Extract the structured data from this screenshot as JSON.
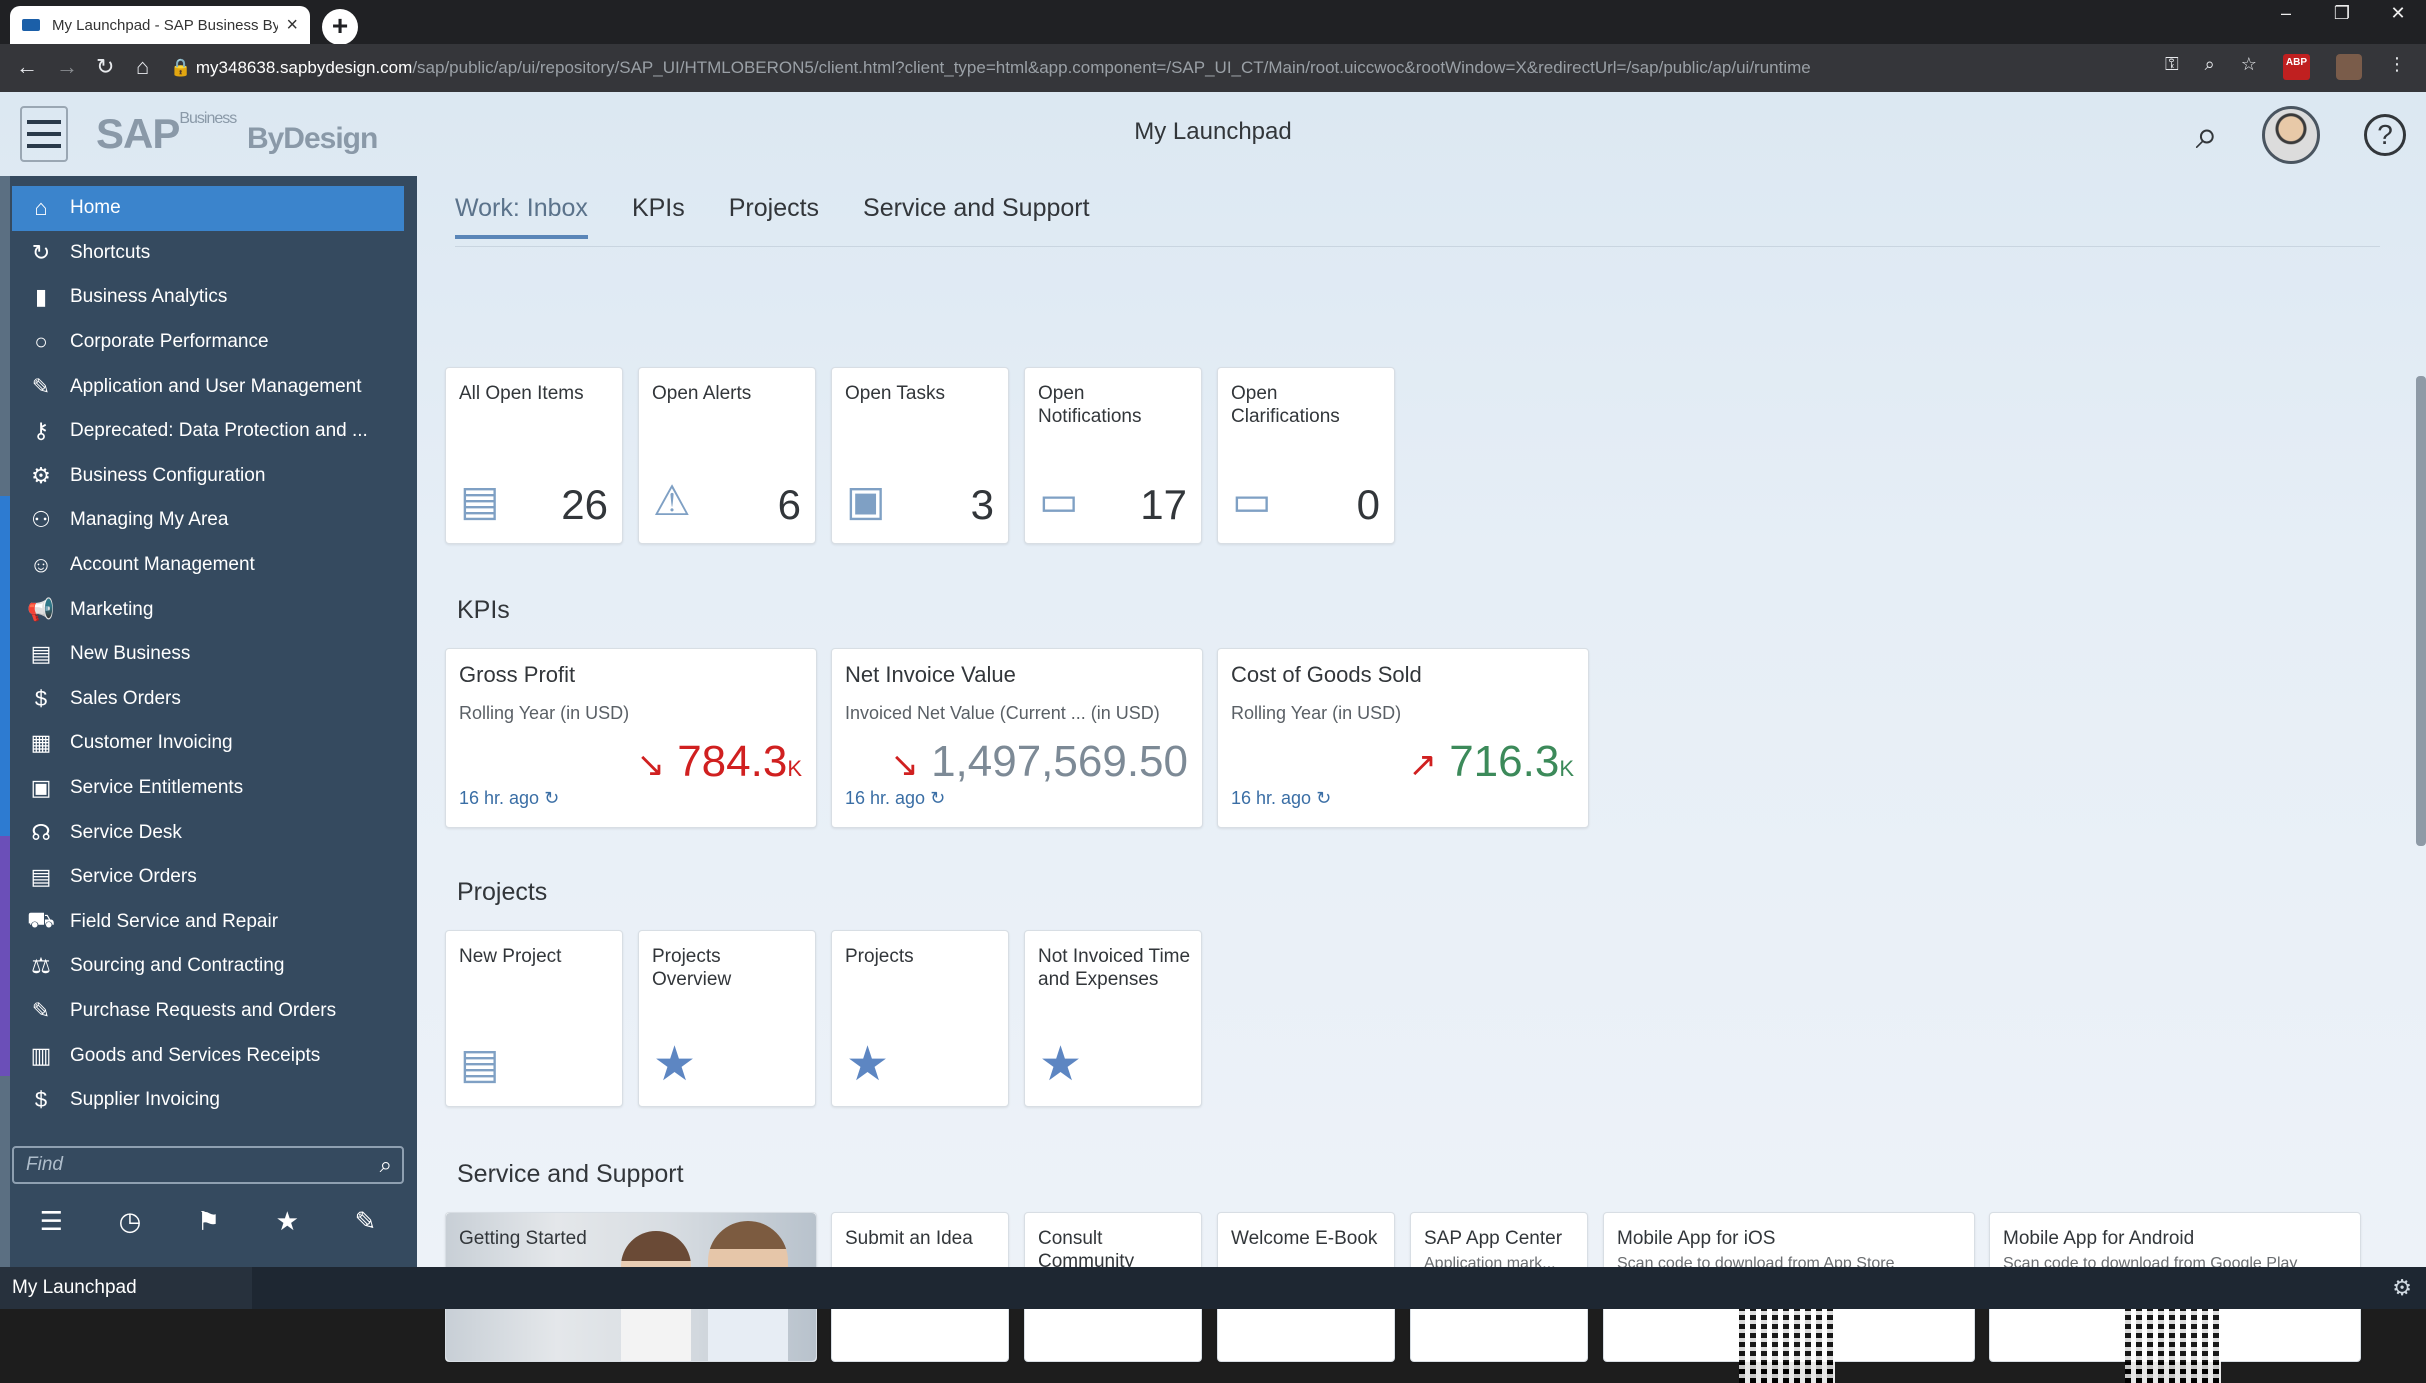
{
  "browser": {
    "tab_title": "My Launchpad - SAP Business By",
    "url_domain": "my348638.sapbydesign.com",
    "url_rest": "/sap/public/ap/ui/repository/SAP_UI/HTMLOBERON5/client.html?client_type=html&app.component=/SAP_UI_CT/Main/root.uiccwoc&rootWindow=X&redirectUrl=/sap/public/ap/ui/runtime"
  },
  "shell": {
    "logo_text": "SAP",
    "logo_sup": "Business",
    "logo_by": "ByDesign",
    "title": "My Launchpad"
  },
  "sidebar": {
    "items": [
      {
        "label": "Home",
        "icon": "home-icon"
      },
      {
        "label": "Shortcuts",
        "icon": "shortcut-icon"
      },
      {
        "label": "Business Analytics",
        "icon": "analytics-icon"
      },
      {
        "label": "Corporate Performance",
        "icon": "circle-icon"
      },
      {
        "label": "Application and User Management",
        "icon": "user-edit-icon"
      },
      {
        "label": "Deprecated: Data Protection and ...",
        "icon": "lock-user-icon"
      },
      {
        "label": "Business Configuration",
        "icon": "gear-icon"
      },
      {
        "label": "Managing My Area",
        "icon": "team-icon"
      },
      {
        "label": "Account Management",
        "icon": "account-icon"
      },
      {
        "label": "Marketing",
        "icon": "megaphone-icon"
      },
      {
        "label": "New Business",
        "icon": "business-card-icon"
      },
      {
        "label": "Sales Orders",
        "icon": "sales-order-icon"
      },
      {
        "label": "Customer Invoicing",
        "icon": "invoice-icon"
      },
      {
        "label": "Service Entitlements",
        "icon": "entitlement-icon"
      },
      {
        "label": "Service Desk",
        "icon": "headset-icon"
      },
      {
        "label": "Service Orders",
        "icon": "service-order-icon"
      },
      {
        "label": "Field Service and Repair",
        "icon": "car-icon"
      },
      {
        "label": "Sourcing and Contracting",
        "icon": "sourcing-icon"
      },
      {
        "label": "Purchase Requests and Orders",
        "icon": "purchase-icon"
      },
      {
        "label": "Goods and Services Receipts",
        "icon": "receipt-icon"
      },
      {
        "label": "Supplier Invoicing",
        "icon": "supplier-invoice-icon"
      }
    ],
    "find_placeholder": "Find"
  },
  "tabs": [
    "Work: Inbox",
    "KPIs",
    "Projects",
    "Service and Support"
  ],
  "inbox_tiles": [
    {
      "title": "All Open Items",
      "count": "26"
    },
    {
      "title": "Open Alerts",
      "count": "6"
    },
    {
      "title": "Open Tasks",
      "count": "3"
    },
    {
      "title": "Open Notifications",
      "count": "17"
    },
    {
      "title": "Open Clarifications",
      "count": "0"
    }
  ],
  "kpis": {
    "section_title": "KPIs",
    "tiles": [
      {
        "title": "Gross Profit",
        "subtitle": "Rolling Year (in USD)",
        "value": "784.3",
        "unit": "K",
        "trend": "down",
        "ago": "16 hr. ago",
        "color": "#d02020"
      },
      {
        "title": "Net Invoice Value",
        "subtitle": "Invoiced Net Value (Current ...  (in USD)",
        "value": "1,497,569.50",
        "unit": "",
        "trend": "down",
        "ago": "16 hr. ago",
        "color": "#7d8a96"
      },
      {
        "title": "Cost of Goods Sold",
        "subtitle": "Rolling Year (in USD)",
        "value": "716.3",
        "unit": "K",
        "trend": "up",
        "ago": "16 hr. ago",
        "color": "#3c8a5a"
      }
    ]
  },
  "projects": {
    "section_title": "Projects",
    "tiles": [
      {
        "title": "New Project"
      },
      {
        "title": "Projects Overview"
      },
      {
        "title": "Projects"
      },
      {
        "title": "Not Invoiced Time and Expenses"
      }
    ]
  },
  "service": {
    "section_title": "Service and Support",
    "tiles": [
      {
        "title": "Getting Started",
        "desc": ""
      },
      {
        "title": "Submit an Idea",
        "desc": ""
      },
      {
        "title": "Consult Community",
        "desc": ""
      },
      {
        "title": "Welcome E-Book",
        "desc": ""
      },
      {
        "title": "SAP App Center",
        "desc": "Application mark..."
      },
      {
        "title": "Mobile App for iOS",
        "desc": "Scan code to download from App Store"
      },
      {
        "title": "Mobile App for Android",
        "desc": "Scan code to download from Google Play"
      }
    ]
  },
  "status": {
    "label": "My Launchpad"
  }
}
